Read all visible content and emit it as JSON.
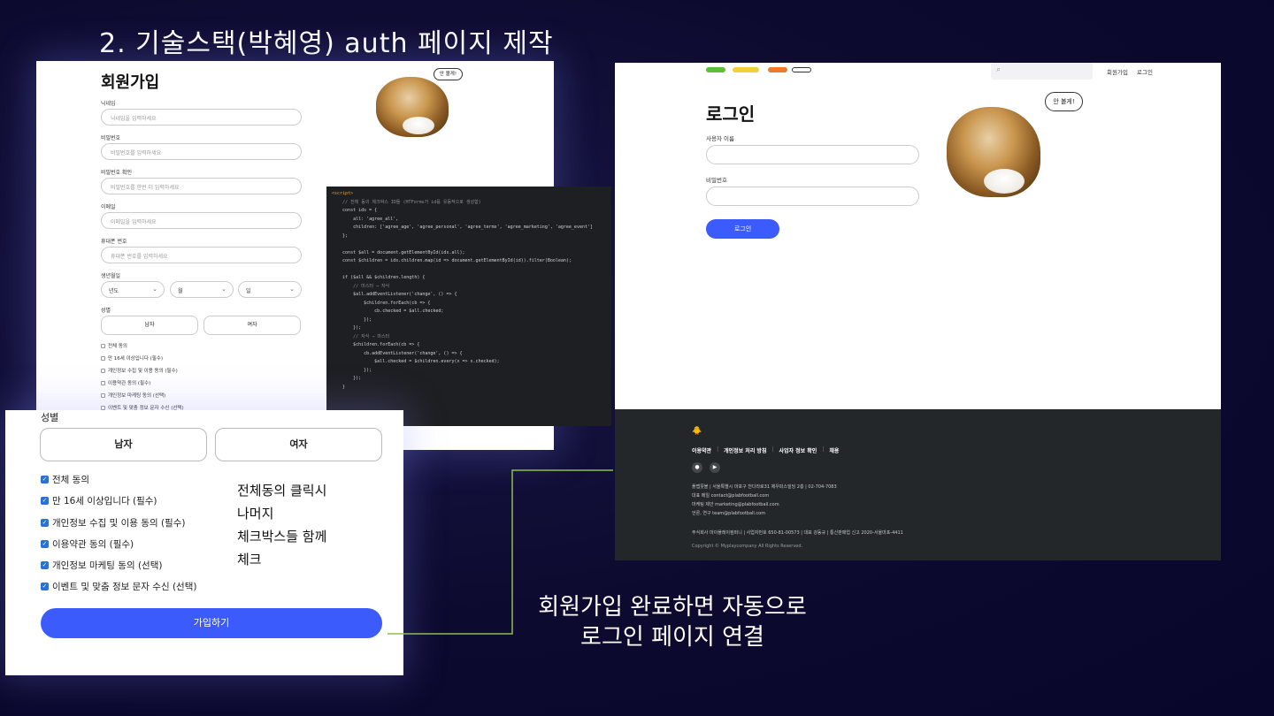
{
  "slide": {
    "title": "2. 기술스택(박혜영) auth 페이지 제작",
    "caption_line1": "회원가입 완료하면 자동으로",
    "caption_line2": "로그인 페이지 연결",
    "connector_color": "#8fbf4a"
  },
  "signup": {
    "title": "회원가입",
    "cat_button": "안 볼게!",
    "fields": [
      {
        "label": "닉네임",
        "placeholder": "닉네임을 입력하세요"
      },
      {
        "label": "비밀번호",
        "placeholder": "비밀번호를 입력하세요"
      },
      {
        "label": "비밀번호 확인",
        "placeholder": "비밀번호를 한번 더 입력하세요"
      },
      {
        "label": "이메일",
        "placeholder": "이메일을 입력하세요"
      },
      {
        "label": "휴대폰 번호",
        "placeholder": "휴대폰 번호를 입력하세요"
      }
    ],
    "birth_label": "생년월일",
    "birth_selects": [
      "년도",
      "월",
      "일"
    ],
    "gender_label": "성별",
    "gender_options": [
      "남자",
      "여자"
    ],
    "checks": [
      "전체 동의",
      "만 16세 이상입니다 (필수)",
      "개인정보 수집 및 이용 동의 (필수)",
      "이용약관 동의 (필수)",
      "개인정보 마케팅 동의 (선택)",
      "이벤트 및 맞춤 정보 문자 수신 (선택)"
    ]
  },
  "code": {
    "lines": [
      "<script>",
      "    // 전체 동의 체크박스 ID들 (HTForms가 id를 유동적으로 생성함)",
      "    const ids = {",
      "        all: 'agree_all',",
      "        children: ['agree_age', 'agree_personal', 'agree_terms', 'agree_marketing', 'agree_event']",
      "    };",
      "",
      "    const $all = document.getElementById(ids.all);",
      "    const $children = ids.children.map(id => document.getElementById(id)).filter(Boolean);",
      "",
      "    if ($all && $children.length) {",
      "        // 마스터 → 자식",
      "        $all.addEventListener('change', () => {",
      "            $children.forEach(cb => {",
      "                cb.checked = $all.checked;",
      "            });",
      "        });",
      "        // 자식 → 마스터",
      "        $children.forEach(cb => {",
      "            cb.addEventListener('change', () => {",
      "                $all.checked = $children.every(x => x.checked);",
      "            });",
      "        });",
      "    }"
    ]
  },
  "login": {
    "nav_signup": "회원가입",
    "nav_login": "로그인",
    "title": "로그인",
    "username_label": "사용자 이름",
    "password_label": "비밀번호",
    "login_button": "로그인",
    "cat_button": "안 볼게!",
    "footer": {
      "links": [
        "이용약관",
        "개인정보 처리 방침",
        "사업자 정보 확인",
        "채용"
      ],
      "company_line": "플랩풋볼 | 서울특별시 마포구 천다라로31 제우피스빌딩 2층 | 02-704-7083",
      "line2": "대표 메일 contact@plabfootball.com",
      "line3": "마케팅 제안 marketing@plabfootball.com",
      "line4": "언론, 연구 team@plabfootball.com",
      "biz_line": "주식회사 마이플레이컴퍼니 | 사업자번호 650-81-00573 | 대표 강동규 | 통신판매업 신고 2020-서울마포-4411",
      "copyright": "Copyright © Myplaycompany All Rights Reserved."
    }
  },
  "zoom": {
    "gender_label": "성별",
    "gender_male": "남자",
    "gender_female": "여자",
    "checks": [
      "전체 동의",
      "만 16세 이상입니다 (필수)",
      "개인정보 수집 및 이용 동의 (필수)",
      "이용약관 동의 (필수)",
      "개인정보 마케팅 동의 (선택)",
      "이벤트 및 맞춤 정보 문자 수신 (선택)"
    ],
    "note_line1": "전체동의 클릭시",
    "note_line2": "나머지",
    "note_line3": "체크박스들 함께",
    "note_line4": "체크",
    "submit": "가입하기"
  }
}
